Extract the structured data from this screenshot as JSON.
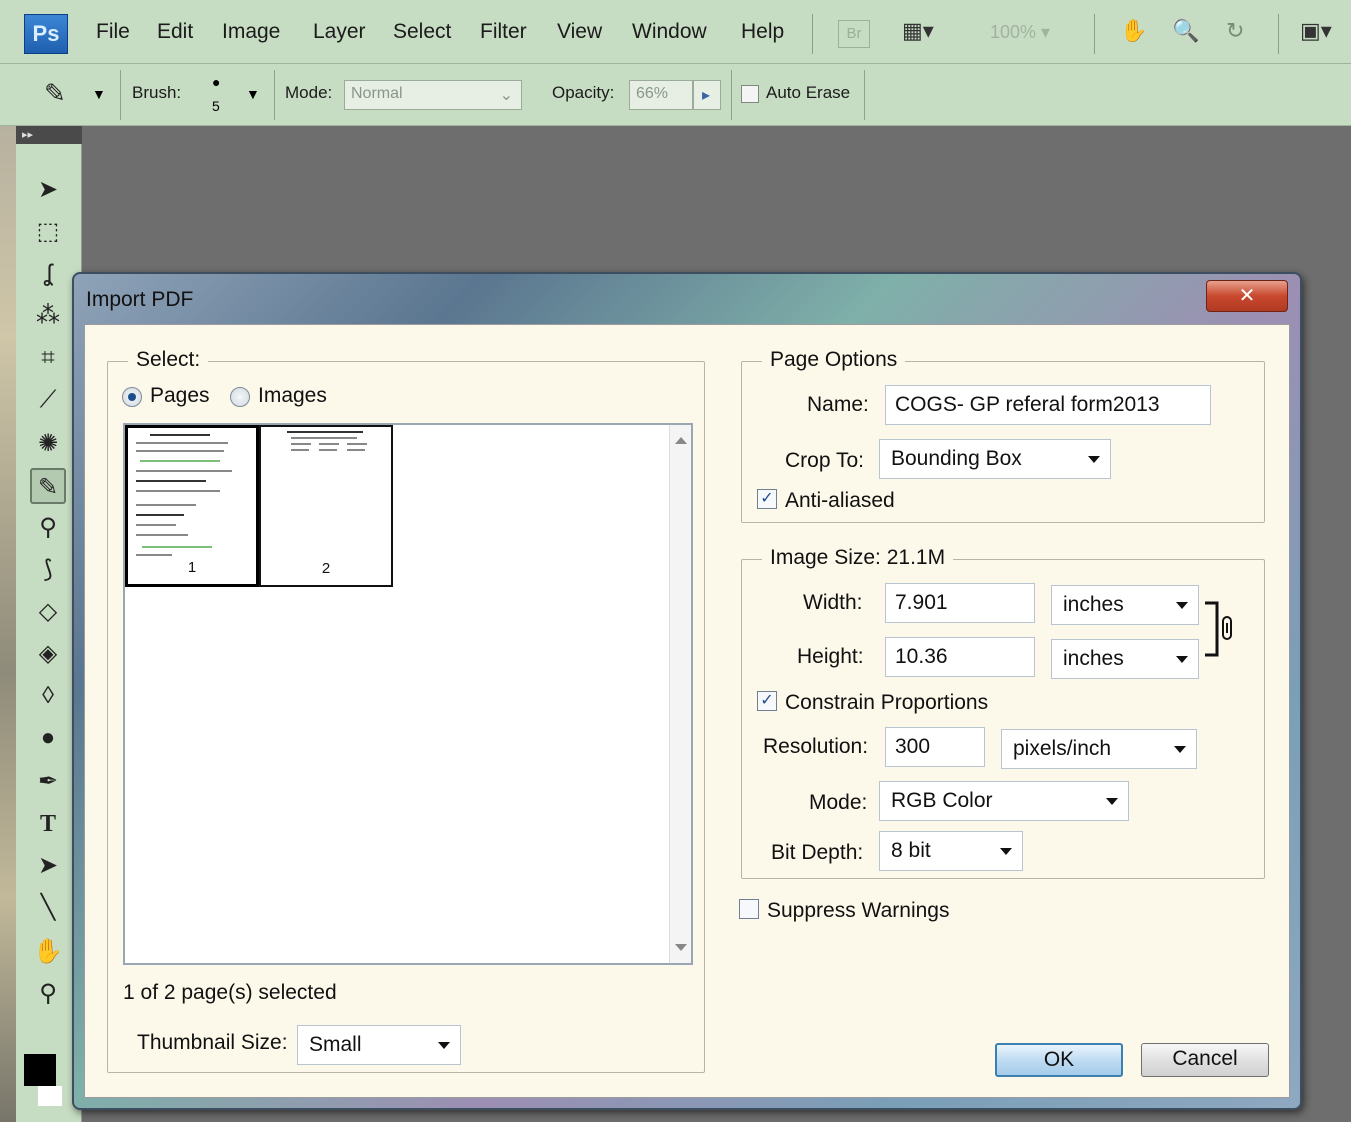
{
  "app": {
    "logo": "Ps",
    "menu": [
      "File",
      "Edit",
      "Image",
      "Layer",
      "Select",
      "Filter",
      "View",
      "Window",
      "Help"
    ],
    "bridge_label": "Br",
    "zoom": "100%"
  },
  "options_bar": {
    "brush_label": "Brush:",
    "brush_size": "5",
    "mode_label": "Mode:",
    "mode_value": "Normal",
    "opacity_label": "Opacity:",
    "opacity_value": "66%",
    "auto_erase_label": "Auto Erase"
  },
  "dialog": {
    "title": "Import PDF",
    "close_glyph": "✕",
    "select": {
      "legend": "Select:",
      "radio_pages": "Pages",
      "radio_images": "Images",
      "selected_radio": "Pages",
      "thumbnails": [
        {
          "page": "1",
          "selected": true
        },
        {
          "page": "2",
          "selected": false
        }
      ],
      "status": "1 of 2 page(s) selected",
      "thumb_size_label": "Thumbnail Size:",
      "thumb_size_value": "Small"
    },
    "page_options": {
      "legend": "Page Options",
      "name_label": "Name:",
      "name_value": "COGS- GP referal form2013",
      "crop_label": "Crop To:",
      "crop_value": "Bounding Box",
      "anti_aliased_label": "Anti-aliased",
      "anti_aliased_checked": true
    },
    "image_size": {
      "legend": "Image Size: 21.1M",
      "width_label": "Width:",
      "width_value": "7.901",
      "width_unit": "inches",
      "height_label": "Height:",
      "height_value": "10.36",
      "height_unit": "inches",
      "constrain_label": "Constrain Proportions",
      "constrain_checked": true,
      "resolution_label": "Resolution:",
      "resolution_value": "300",
      "resolution_unit": "pixels/inch",
      "mode_label": "Mode:",
      "mode_value": "RGB Color",
      "bit_depth_label": "Bit Depth:",
      "bit_depth_value": "8 bit"
    },
    "suppress_warnings_label": "Suppress Warnings",
    "suppress_warnings_checked": false,
    "ok_label": "OK",
    "cancel_label": "Cancel"
  },
  "colors": {
    "chrome_green": "#c7ddc3",
    "dialog_bg": "#fcf8ea",
    "close_red": "#c8492e",
    "ok_blue": "#3c7fb1"
  }
}
